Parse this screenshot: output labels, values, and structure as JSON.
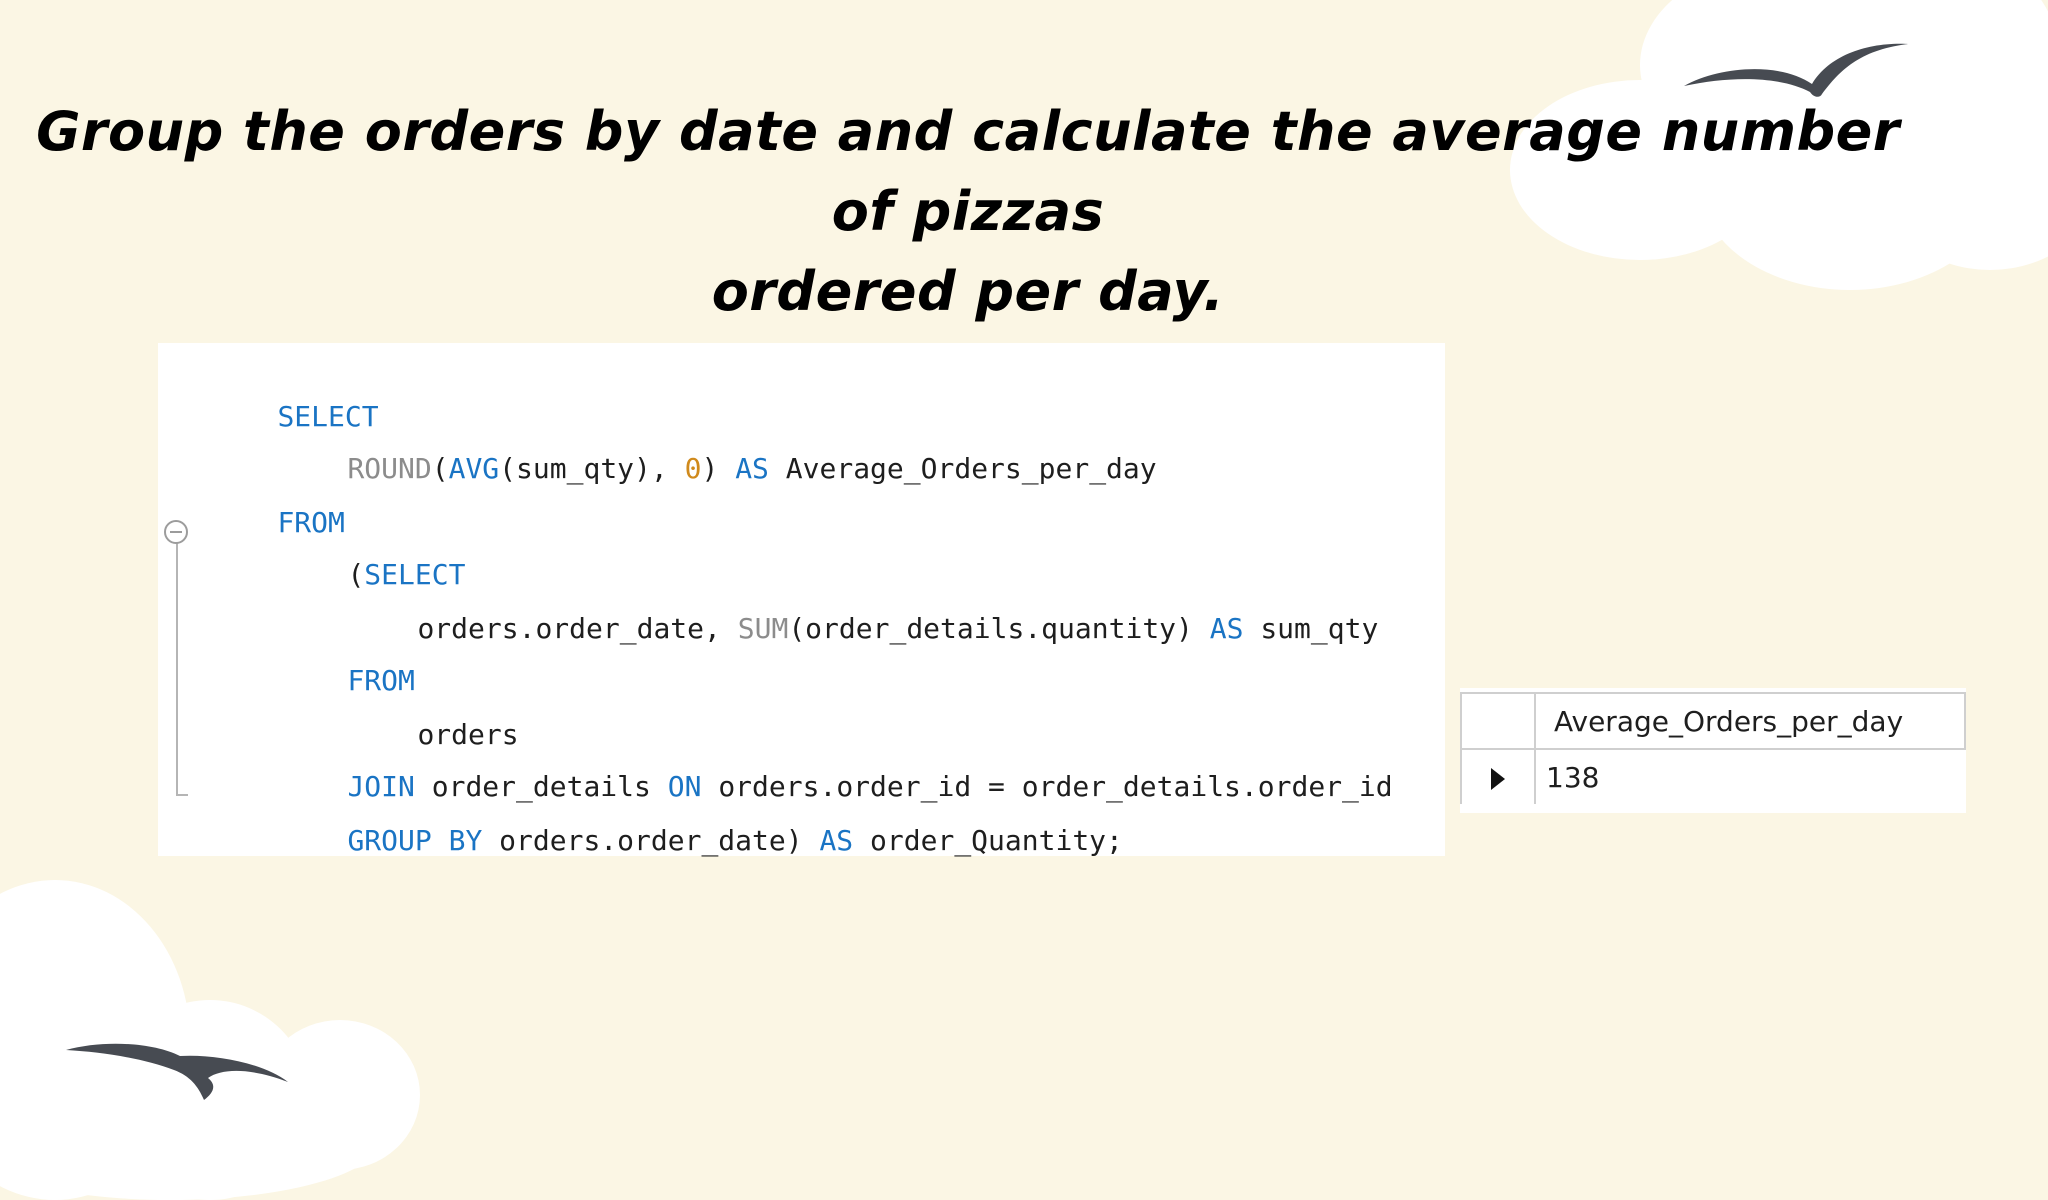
{
  "title": {
    "line1": "Group the orders by date and calculate the average number of pizzas",
    "line2": "ordered per day."
  },
  "code": {
    "l1": {
      "a": "SELECT"
    },
    "l2": {
      "a": "ROUND",
      "b": "(",
      "c": "AVG",
      "d": "(sum_qty), ",
      "e": "0",
      "f": ") ",
      "g": "AS",
      "h": " Average_Orders_per_day"
    },
    "l3": {
      "a": "FROM"
    },
    "l4": {
      "a": "(",
      "b": "SELECT"
    },
    "l5": {
      "a": "orders.order_date, ",
      "b": "SUM",
      "c": "(order_details.quantity) ",
      "d": "AS",
      "e": " sum_qty"
    },
    "l6": {
      "a": "FROM"
    },
    "l7": {
      "a": "orders"
    },
    "l8": {
      "a": "JOIN",
      "b": " order_details ",
      "c": "ON",
      "d": " orders.order_id = order_details.order_id"
    },
    "l9": {
      "a": "GROUP BY",
      "b": " orders.order_date) ",
      "c": "AS",
      "d": " order_Quantity;"
    }
  },
  "result": {
    "column_header": "Average_Orders_per_day",
    "rows": [
      {
        "value": "138"
      }
    ]
  },
  "colors": {
    "background": "#fbf6e4",
    "keyword": "#1a74c4",
    "function": "#8c8c8c",
    "number": "#d08a1c"
  },
  "icons": {
    "fold": "collapse-minus-icon",
    "row_marker": "row-pointer-icon",
    "decor": "seagull-icon"
  }
}
